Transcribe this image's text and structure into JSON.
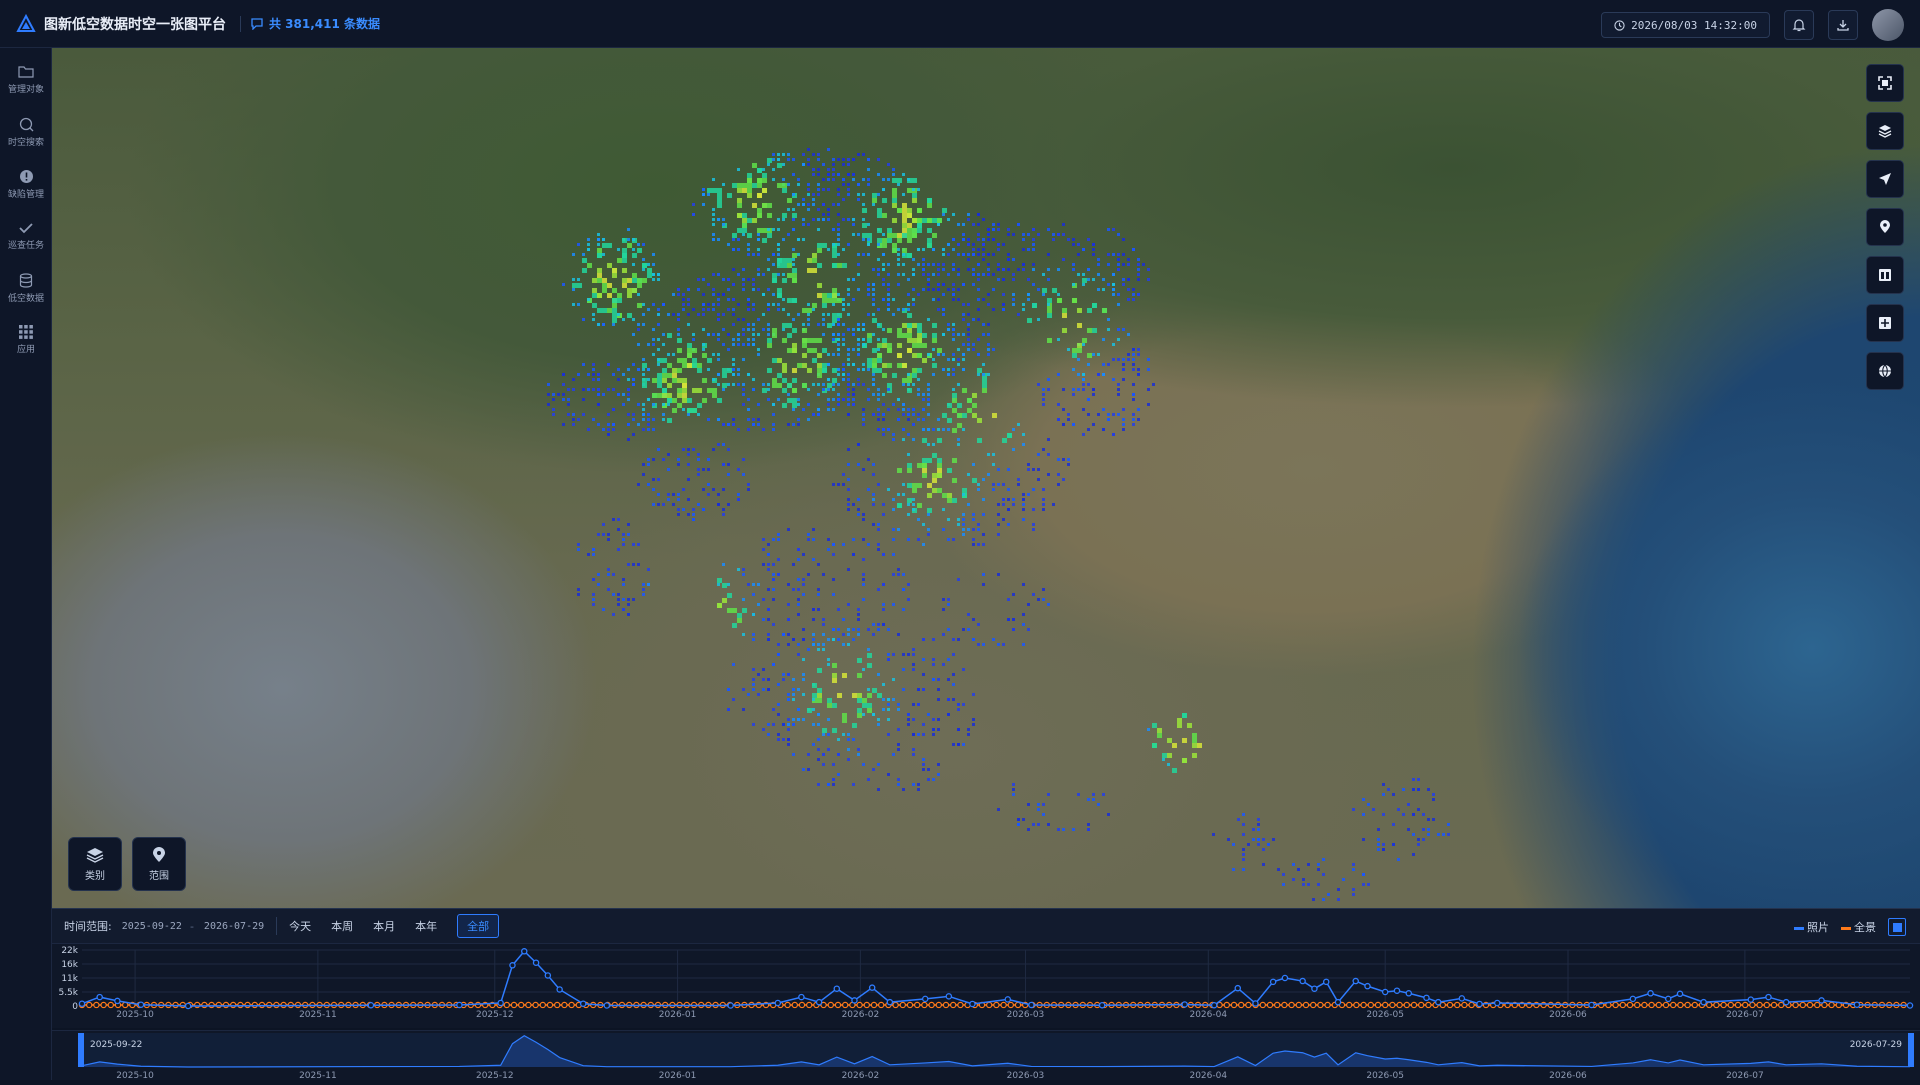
{
  "app": {
    "title": "图新低空数据时空一张图平台",
    "record_count": "共 381,411 条数据",
    "datetime": "2026/08/03 14:32:00"
  },
  "colors": {
    "accent": "#2f7cff",
    "photo_series": "#2f7cff",
    "pano_series": "#ff7a1a",
    "panel_bg": "#0e1628"
  },
  "sidebar": {
    "items": [
      {
        "label": "管理对象",
        "icon": "folder-icon"
      },
      {
        "label": "时空搜索",
        "icon": "search-icon"
      },
      {
        "label": "缺陷管理",
        "icon": "alert-icon"
      },
      {
        "label": "巡查任务",
        "icon": "check-icon"
      },
      {
        "label": "低空数据",
        "icon": "database-icon"
      },
      {
        "label": "应用",
        "icon": "grid-icon"
      }
    ]
  },
  "map_tools": {
    "items": [
      "fullscreen-icon",
      "layers-icon",
      "navigate-icon",
      "pin-icon",
      "panel-icon",
      "grid-view-icon",
      "globe-icon"
    ]
  },
  "map_buttons": {
    "category": "类别",
    "range": "范围"
  },
  "timeline": {
    "range_label": "时间范围:",
    "start": "2025-09-22",
    "end": "2026-07-29",
    "dash": "-",
    "quick": [
      "今天",
      "本周",
      "本月",
      "本年",
      "全部"
    ],
    "active_quick": "全部",
    "legend": {
      "photo": "照片",
      "pano": "全景"
    }
  },
  "chart_data": {
    "type": "line",
    "title": "",
    "xlabel": "",
    "ylabel": "",
    "y_ticks": [
      "22k",
      "16k",
      "11k",
      "5.5k",
      "0"
    ],
    "ylim": [
      0,
      22000
    ],
    "x_ticks": [
      "2025-10",
      "2025-11",
      "2025-12",
      "2026-01",
      "2026-02",
      "2026-03",
      "2026-04",
      "2026-05",
      "2026-06",
      "2026-07"
    ],
    "series": [
      {
        "name": "照片",
        "points": [
          [
            "2025-09-22",
            900
          ],
          [
            "2025-09-25",
            3500
          ],
          [
            "2025-09-28",
            2000
          ],
          [
            "2025-10-02",
            500
          ],
          [
            "2025-10-10",
            0
          ],
          [
            "2025-11-10",
            300
          ],
          [
            "2025-11-25",
            400
          ],
          [
            "2025-12-02",
            1200
          ],
          [
            "2025-12-04",
            16000
          ],
          [
            "2025-12-06",
            21500
          ],
          [
            "2025-12-08",
            17000
          ],
          [
            "2025-12-10",
            12000
          ],
          [
            "2025-12-12",
            6500
          ],
          [
            "2025-12-16",
            900
          ],
          [
            "2025-12-20",
            200
          ],
          [
            "2026-01-10",
            200
          ],
          [
            "2026-01-18",
            1200
          ],
          [
            "2026-01-22",
            3500
          ],
          [
            "2026-01-25",
            1500
          ],
          [
            "2026-01-28",
            6800
          ],
          [
            "2026-01-31",
            2200
          ],
          [
            "2026-02-03",
            7200
          ],
          [
            "2026-02-06",
            1500
          ],
          [
            "2026-02-12",
            2800
          ],
          [
            "2026-02-16",
            3800
          ],
          [
            "2026-02-20",
            800
          ],
          [
            "2026-02-26",
            2600
          ],
          [
            "2026-03-02",
            400
          ],
          [
            "2026-03-14",
            300
          ],
          [
            "2026-03-28",
            600
          ],
          [
            "2026-04-02",
            300
          ],
          [
            "2026-04-06",
            7000
          ],
          [
            "2026-04-09",
            1000
          ],
          [
            "2026-04-12",
            9500
          ],
          [
            "2026-04-14",
            11000
          ],
          [
            "2026-04-17",
            9800
          ],
          [
            "2026-04-19",
            6800
          ],
          [
            "2026-04-21",
            9500
          ],
          [
            "2026-04-23",
            1500
          ],
          [
            "2026-04-26",
            9800
          ],
          [
            "2026-04-28",
            7800
          ],
          [
            "2026-05-01",
            5500
          ],
          [
            "2026-05-03",
            6000
          ],
          [
            "2026-05-05",
            5000
          ],
          [
            "2026-05-08",
            3200
          ],
          [
            "2026-05-10",
            1500
          ],
          [
            "2026-05-14",
            3000
          ],
          [
            "2026-05-17",
            800
          ],
          [
            "2026-05-20",
            1200
          ],
          [
            "2026-06-05",
            400
          ],
          [
            "2026-06-12",
            2800
          ],
          [
            "2026-06-15",
            5000
          ],
          [
            "2026-06-18",
            2800
          ],
          [
            "2026-06-20",
            4800
          ],
          [
            "2026-06-24",
            1500
          ],
          [
            "2026-07-02",
            2500
          ],
          [
            "2026-07-05",
            3500
          ],
          [
            "2026-07-08",
            1500
          ],
          [
            "2026-07-14",
            2200
          ],
          [
            "2026-07-20",
            500
          ],
          [
            "2026-07-29",
            200
          ]
        ]
      },
      {
        "name": "全景",
        "points": [
          [
            "2025-09-22",
            400
          ],
          [
            "2026-07-29",
            400
          ]
        ]
      }
    ]
  }
}
